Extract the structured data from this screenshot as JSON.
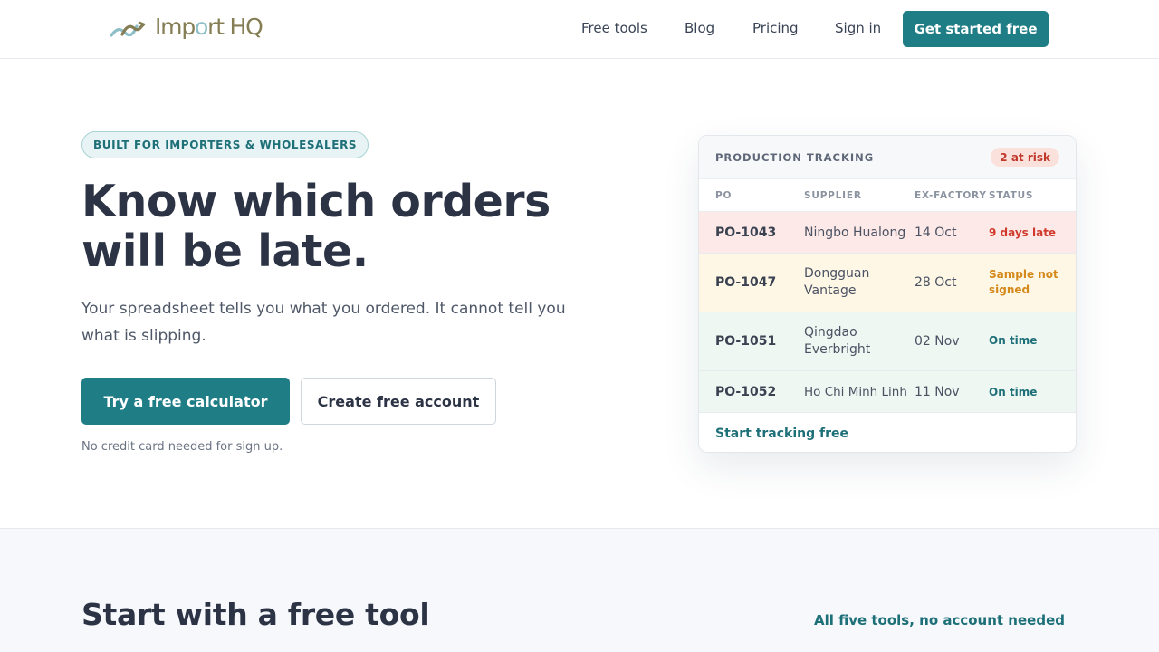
{
  "brand": {
    "name_part1": "Imp",
    "name_o": "o",
    "name_part2": "rt HQ"
  },
  "nav": {
    "links": [
      "Free tools",
      "Blog",
      "Pricing",
      "Sign in"
    ],
    "cta": "Get started free"
  },
  "hero": {
    "pill": "BUILT FOR IMPORTERS & WHOLESALERS",
    "headline_line1": "Know which orders",
    "headline_line2": "will be late.",
    "subline": "Your spreadsheet tells you what you ordered. It cannot tell you what is slipping.",
    "primary_button": "Try a free calculator",
    "secondary_button": "Create free account",
    "note": "No credit card needed for sign up."
  },
  "card": {
    "title": "PRODUCTION TRACKING",
    "badge": "2 at risk",
    "columns": [
      "PO",
      "SUPPLIER",
      "EX-FACTORY",
      "STATUS"
    ],
    "rows": [
      {
        "po": "PO-1043",
        "supplier": "Ningbo Hualong",
        "date": "14 Oct",
        "status": "9 days late"
      },
      {
        "po": "PO-1047",
        "supplier": "Dongguan Vantage",
        "date": "28 Oct",
        "status": "Sample not signed"
      },
      {
        "po": "PO-1051",
        "supplier": "Qingdao Everbright",
        "date": "02 Nov",
        "status": "On time"
      },
      {
        "po": "PO-1052",
        "supplier": "Ho Chi Minh Linh",
        "date": "11 Nov",
        "status": "On time"
      }
    ],
    "footer_link": "Start tracking free"
  },
  "colors": {
    "accent": "#1f7d86",
    "late_bg": "#fde9e7",
    "late_text": "#d0392b",
    "risk_bg": "#fff7e6",
    "risk_text": "#d4891a",
    "ok_bg": "#eef7f1",
    "ok_text": "#1d6f78"
  },
  "tools_section": {
    "title": "Start with a free tool",
    "link": "All five tools, no account needed"
  }
}
